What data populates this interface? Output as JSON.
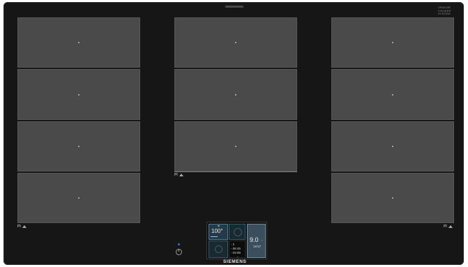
{
  "brand": {
    "logo_text": "SIEMENS",
    "badge_lines": [
      "SENSOR",
      "COOKER",
      "SYSTEM"
    ]
  },
  "zone_markers": {
    "left_pm": "PI",
    "middle_pm": "PI",
    "right_pm": "PI"
  },
  "control_panel": {
    "temperature_label": "100°",
    "timers": [
      {
        "icon": "timer-icon",
        "value": "2"
      },
      {
        "icon": "clock-icon",
        "value": "06:45"
      },
      {
        "icon": "hourglass-icon",
        "value": "03:08"
      }
    ],
    "power_level": "9.0",
    "cook_time": "19:57"
  },
  "colors": {
    "surface": "#161616",
    "zone": "#4a4a4a",
    "panel_accent": "#4e7f96",
    "led": "#3a6fd8"
  }
}
